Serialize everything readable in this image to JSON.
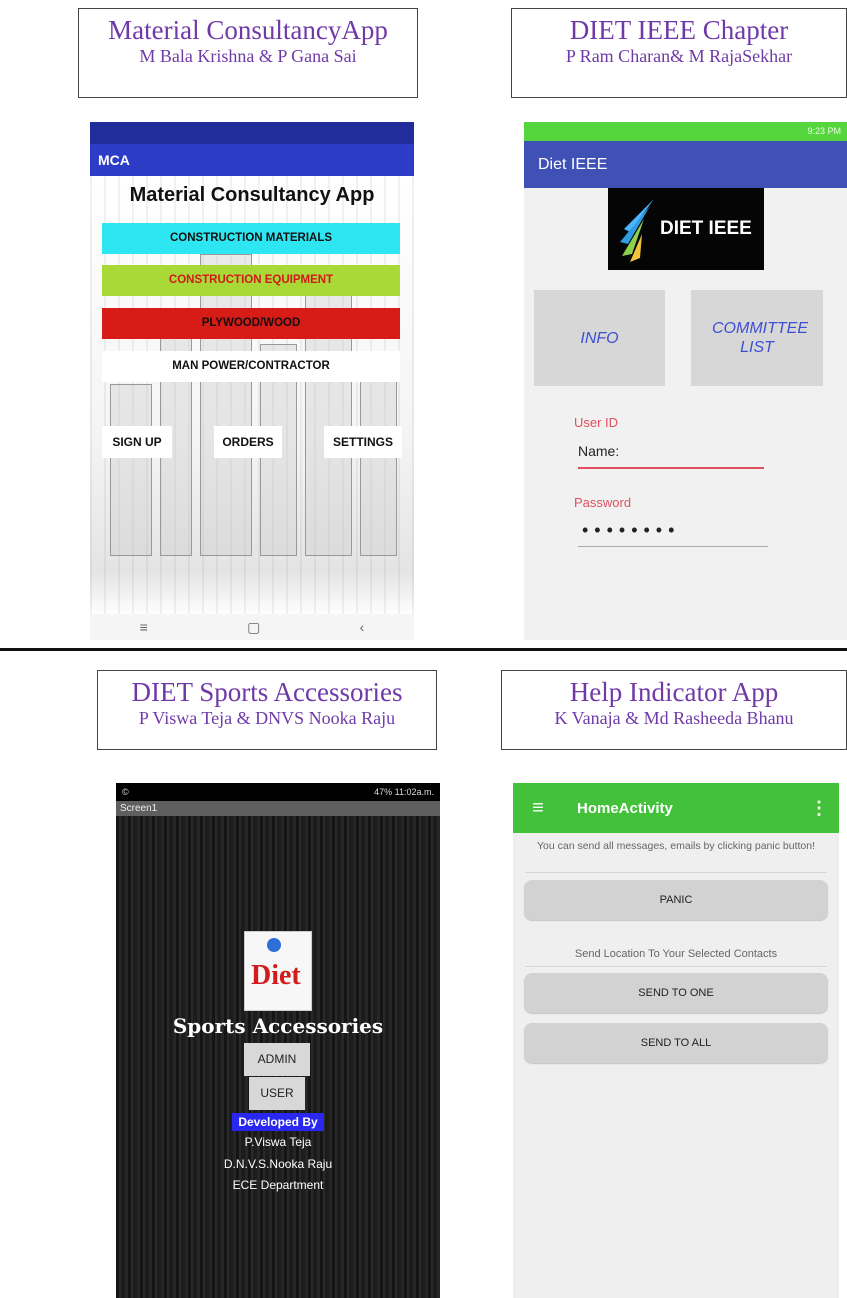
{
  "captions": [
    {
      "title": "Material ConsultancyApp",
      "subtitle": "M Bala Krishna & P Gana Sai"
    },
    {
      "title": "DIET IEEE Chapter",
      "subtitle": "P Ram Charan& M RajaSekhar"
    },
    {
      "title": "DIET Sports Accessories",
      "subtitle": "P Viswa Teja & DNVS Nooka Raju"
    },
    {
      "title": "Help Indicator App",
      "subtitle": "K Vanaja & Md Rasheeda Bhanu"
    }
  ],
  "mca": {
    "appbar": "MCA",
    "title": "Material Consultancy App",
    "menu": [
      {
        "label": "CONSTRUCTION MATERIALS",
        "bg": "#2ee6f2",
        "fg": "#111111"
      },
      {
        "label": "CONSTRUCTION EQUIPMENT",
        "bg": "#a8d936",
        "fg": "#d11a1a"
      },
      {
        "label": "PLYWOOD/WOOD",
        "bg": "#d71b17",
        "fg": "#111111"
      },
      {
        "label": "MAN POWER/CONTRACTOR",
        "bg": "#ffffff",
        "fg": "#111111"
      }
    ],
    "bottom_buttons": [
      "SIGN UP",
      "ORDERS",
      "SETTINGS"
    ],
    "nav": {
      "menu": "≡",
      "home": "▢",
      "back": "‹"
    }
  },
  "ieee": {
    "appbar": "Diet IEEE",
    "logo_text": "DIET IEEE",
    "tiles": [
      "INFO",
      "COMMITTEE LIST"
    ],
    "user_label": "User ID",
    "user_placeholder": "Name:",
    "password_label": "Password",
    "password_value": "••••••••",
    "status_time": "9:23 PM"
  },
  "sports": {
    "status_time": "11:02a.m.",
    "status_battery": "47%",
    "screen_title": "Screen1",
    "logo_text": "Diet",
    "title": "Sports Accessories",
    "admin_label": "ADMIN",
    "user_label": "USER",
    "developed_by": "Developed By",
    "dev_lines": [
      "P.Viswa Teja",
      "D.N.V.S.Nooka Raju",
      "ECE Department"
    ]
  },
  "help": {
    "appbar": "HomeActivity",
    "message": "You can send all messages, emails by clicking panic button!",
    "panic_label": "PANIC",
    "location_text": "Send Location To Your Selected Contacts",
    "send_one_label": "SEND TO ONE",
    "send_all_label": "SEND TO ALL"
  }
}
